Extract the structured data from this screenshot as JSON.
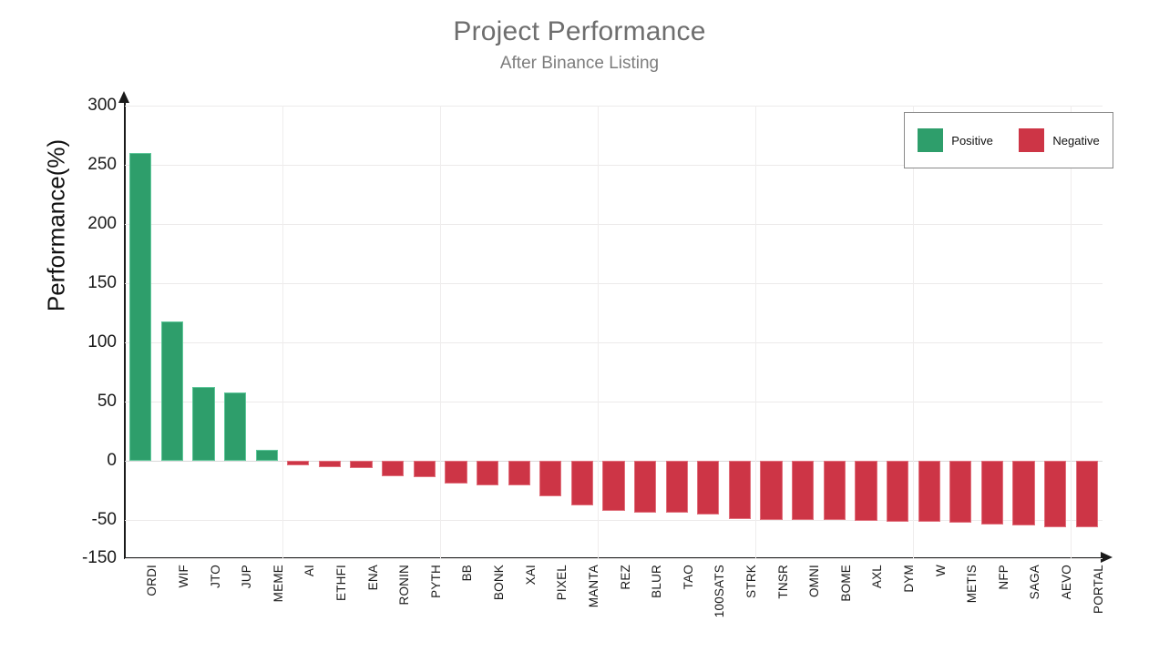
{
  "header": {
    "title": "Project Performance",
    "subtitle": "After Binance Listing"
  },
  "legend": {
    "position": "top-right",
    "items": [
      {
        "label": "Positive",
        "color": "#2e9e6b"
      },
      {
        "label": "Negative",
        "color": "#cd3546"
      }
    ]
  },
  "axes": {
    "ylabel": "Performance(%)",
    "xlabel": "",
    "yticks": [
      300,
      250,
      200,
      150,
      100,
      50,
      0,
      -50,
      -150
    ],
    "ytick_labels": [
      "300",
      "250",
      "200",
      "150",
      "100",
      "50",
      "0",
      "-50",
      "-150"
    ],
    "ylim": [
      -150,
      300
    ],
    "grid": "horizontal-and-vertical"
  },
  "chart_data": {
    "type": "bar",
    "title": "Project Performance",
    "subtitle": "After Binance Listing",
    "xlabel": "",
    "ylabel": "Performance(%)",
    "ylim": [
      -150,
      300
    ],
    "yticks": [
      300,
      250,
      200,
      150,
      100,
      50,
      0,
      -50,
      -150
    ],
    "grid": true,
    "legend": [
      "Positive",
      "Negative"
    ],
    "colors": {
      "positive": "#2e9e6b",
      "negative": "#cd3546"
    },
    "categories": [
      "ORDI",
      "WIF",
      "JTO",
      "JUP",
      "MEME",
      "AI",
      "ETHFI",
      "ENA",
      "RONIN",
      "PYTH",
      "BB",
      "BONK",
      "XAI",
      "PIXEL",
      "MANTA",
      "REZ",
      "BLUR",
      "TAO",
      "100SATS",
      "STRK",
      "TNSR",
      "OMNI",
      "BOME",
      "AXL",
      "DYM",
      "W",
      "METIS",
      "NFP",
      "SAGA",
      "AEVO",
      "PORTAL"
    ],
    "values": [
      260,
      118,
      62,
      58,
      9,
      -4,
      -5,
      -6,
      -13,
      -14,
      -19,
      -21,
      -21,
      -30,
      -38,
      -42,
      -44,
      -44,
      -45,
      -49,
      -50,
      -51,
      -51,
      -53,
      -54,
      -55,
      -58,
      -61,
      -64,
      -68,
      -69
    ]
  }
}
